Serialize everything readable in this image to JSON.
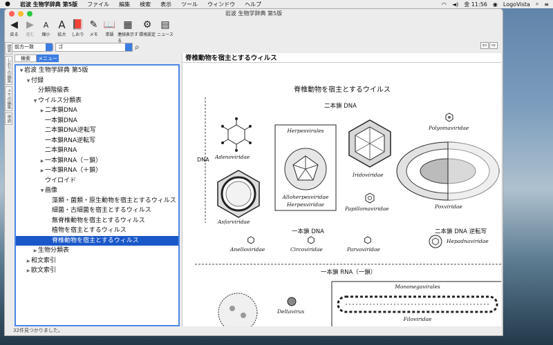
{
  "menubar": {
    "app": "岩波 生物学辞典 第5版",
    "items": [
      "ファイル",
      "編集",
      "検索",
      "表示",
      "ツール",
      "ウィンドウ",
      "ヘルプ"
    ],
    "clock": "金 11:56",
    "provider": "LogoVista"
  },
  "window": {
    "title": "岩波 生物学辞典 第5版"
  },
  "toolbar": [
    {
      "icon": "back-icon",
      "label": "戻る",
      "enabled": true
    },
    {
      "icon": "forward-icon",
      "label": "進む",
      "enabled": false
    },
    {
      "icon": "shrink-font-icon",
      "label": "縮小",
      "enabled": true
    },
    {
      "icon": "enlarge-font-icon",
      "label": "拡大",
      "enabled": true
    },
    {
      "icon": "bookmark-icon",
      "label": "しおり",
      "enabled": true
    },
    {
      "icon": "memo-icon",
      "label": "メモ",
      "enabled": true
    },
    {
      "icon": "wordbook-icon",
      "label": "単語",
      "enabled": true
    },
    {
      "icon": "multi-display-icon",
      "label": "連続表示する",
      "enabled": true
    },
    {
      "icon": "settings-icon",
      "label": "環境設定",
      "enabled": true
    },
    {
      "icon": "news-icon",
      "label": "ニュース",
      "enabled": true
    }
  ],
  "search": {
    "mode": "前方一致",
    "query": "ゴ"
  },
  "tabs": {
    "search": "検索",
    "menu": "メニュー"
  },
  "sidetabs": [
    "検",
    "索",
    "し",
    "お",
    "り",
    "の",
    "編",
    "集",
    "メ",
    "モ",
    "の",
    "編",
    "集",
    "単",
    "語"
  ],
  "tree": [
    {
      "label": "岩波 生物学辞典 第5版",
      "level": 0,
      "arrow": "▼"
    },
    {
      "label": "付録",
      "level": 1,
      "arrow": "▼"
    },
    {
      "label": "分類階級表",
      "level": 2,
      "arrow": ""
    },
    {
      "label": "ウイルス分類表",
      "level": 2,
      "arrow": "▼"
    },
    {
      "label": "二本鎖DNA",
      "level": 3,
      "arrow": "▶"
    },
    {
      "label": "一本鎖DNA",
      "level": 3,
      "arrow": ""
    },
    {
      "label": "二本鎖DNA逆転写",
      "level": 3,
      "arrow": ""
    },
    {
      "label": "一本鎖RNA逆転写",
      "level": 3,
      "arrow": ""
    },
    {
      "label": "二本鎖RNA",
      "level": 3,
      "arrow": ""
    },
    {
      "label": "一本鎖RNA（－鎖）",
      "level": 3,
      "arrow": "▶"
    },
    {
      "label": "一本鎖RNA（＋鎖）",
      "level": 3,
      "arrow": "▶"
    },
    {
      "label": "ウイロイド",
      "level": 3,
      "arrow": ""
    },
    {
      "label": "画像",
      "level": 3,
      "arrow": "▼"
    },
    {
      "label": "藻類・菌類・原生動物を宿主とするウィルス",
      "level": 4,
      "arrow": ""
    },
    {
      "label": "細菌・古細菌を宿主とするウィルス",
      "level": 4,
      "arrow": ""
    },
    {
      "label": "無脊椎動物を宿主とするウィルス",
      "level": 4,
      "arrow": ""
    },
    {
      "label": "植物を宿主とするウィルス",
      "level": 4,
      "arrow": ""
    },
    {
      "label": "脊椎動物を宿主とするウィルス",
      "level": 4,
      "arrow": "",
      "selected": true
    },
    {
      "label": "生物分類表",
      "level": 2,
      "arrow": "▶"
    },
    {
      "label": "和文索引",
      "level": 1,
      "arrow": "▶"
    },
    {
      "label": "欧文索引",
      "level": 1,
      "arrow": "▶"
    }
  ],
  "status": "32件見つかりました。",
  "content": {
    "heading": "脊椎動物を宿主とするウィルス",
    "figure": {
      "title": "脊椎動物を宿主とするウイルス",
      "dsDNA": "二本鎖 DNA",
      "ssDNA": "一本鎖 DNA",
      "dsDNA_rt": "二本鎖 DNA 逆転写",
      "ssRNA_neg": "一本鎖 RNA（一鎖）",
      "axis": "DNA",
      "box_title": "Herpesvirales",
      "names": {
        "adeno": "Adenoviridae",
        "asfar": "Asfarviridae",
        "allo": "Alloherpesviridae",
        "herpes": "Herpesviridae",
        "irido": "Iridoviridae",
        "papilloma": "Papillomaviridae",
        "polyoma": "Polyomaviridae",
        "pox": "Poxviridae",
        "anello": "Anelloviridae",
        "circo": "Circoviridae",
        "parvo": "Parvoviridae",
        "hepadna": "Hepadnaviridae",
        "delta": "Deltavirus",
        "mononega": "Mononegavirales",
        "filo": "Filoviridae"
      }
    }
  },
  "colors": {
    "accent": "#3c7de1",
    "selection": "#1a58c9"
  }
}
